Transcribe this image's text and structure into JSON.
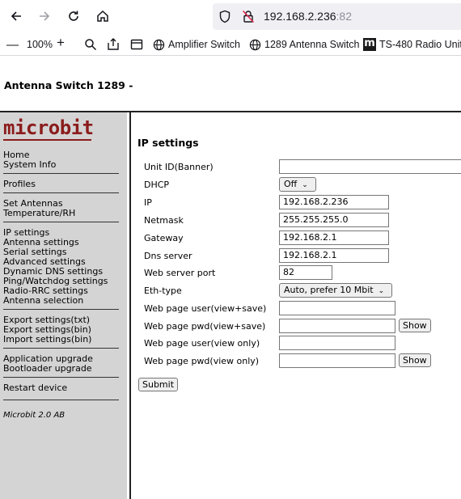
{
  "browser": {
    "url_host": "192.168.2.236",
    "url_port": ":82",
    "zoom": "100%",
    "zoom_out": "—",
    "zoom_in": "+",
    "bookmarks": [
      "Amplifier Switch",
      "1289 Antenna Switch",
      "TS-480 Radio Unit"
    ],
    "bookmark_logo": "m"
  },
  "page": {
    "title": "Antenna Switch 1289 -"
  },
  "sidebar": {
    "logo": "microbit",
    "groups": [
      [
        "Home",
        "System Info"
      ],
      [
        "Profiles"
      ],
      [
        "Set Antennas",
        "Temperature/RH"
      ],
      [
        "IP settings",
        "Antenna settings",
        "Serial settings",
        "Advanced settings",
        "Dynamic DNS settings",
        "Ping/Watchdog settings",
        "Radio-RRC settings",
        "Antenna selection"
      ],
      [
        "Export settings(txt)",
        "Export settings(bin)",
        "Import settings(bin)"
      ],
      [
        "Application upgrade",
        "Bootloader upgrade"
      ],
      [
        "Restart device"
      ]
    ],
    "footer": "Microbit 2.0 AB"
  },
  "form": {
    "title": "IP settings",
    "fields": [
      {
        "label": "Unit ID(Banner)",
        "value": ""
      },
      {
        "label": "DHCP",
        "value": "Off"
      },
      {
        "label": "IP",
        "value": "192.168.2.236"
      },
      {
        "label": "Netmask",
        "value": "255.255.255.0"
      },
      {
        "label": "Gateway",
        "value": "192.168.2.1"
      },
      {
        "label": "Dns server",
        "value": "192.168.2.1"
      },
      {
        "label": "Web server port",
        "value": "82"
      },
      {
        "label": "Eth-type",
        "value": "Auto, prefer 10 Mbit"
      },
      {
        "label": "Web page user(view+save)",
        "value": ""
      },
      {
        "label": "Web page pwd(view+save)",
        "value": ""
      },
      {
        "label": "Web page user(view only)",
        "value": ""
      },
      {
        "label": "Web page pwd(view only)",
        "value": ""
      }
    ],
    "show_label": "Show",
    "submit_label": "Submit"
  }
}
